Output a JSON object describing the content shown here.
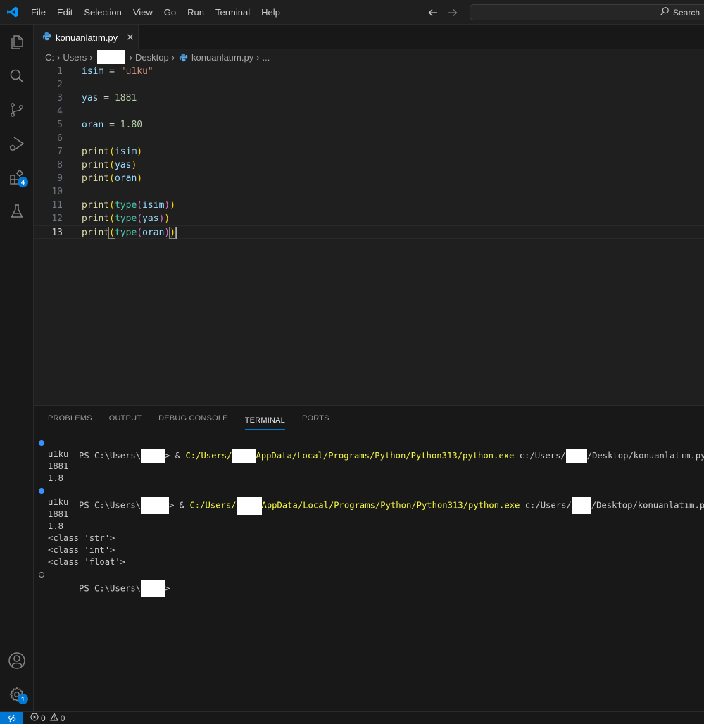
{
  "menu": [
    "File",
    "Edit",
    "Selection",
    "View",
    "Go",
    "Run",
    "Terminal",
    "Help"
  ],
  "search": {
    "label": "Search"
  },
  "activity": {
    "extensions_badge": "4",
    "settings_badge": "1"
  },
  "tab": {
    "label": "konuanlatım.py",
    "close": "×"
  },
  "breadcrumb": {
    "drive": "C:",
    "users": "Users",
    "desktop": "Desktop",
    "file": "konuanlatım.py",
    "more": "..."
  },
  "editor": {
    "line_numbers": [
      "1",
      "2",
      "3",
      "4",
      "5",
      "6",
      "7",
      "8",
      "9",
      "10",
      "11",
      "12",
      "13"
    ],
    "current_line": 13,
    "code": {
      "l1_var": "isim",
      "l1_op": " = ",
      "l1_val": "\"u1ku\"",
      "l3_var": "yas",
      "l3_op": " = ",
      "l3_val": "1881",
      "l5_var": "oran",
      "l5_op": " = ",
      "l5_val": "1.80",
      "print": "print",
      "type": "type",
      "isim": "isim",
      "yas": "yas",
      "oran": "oran",
      "lp": "(",
      "rp": ")"
    }
  },
  "panel": {
    "tabs": [
      "PROBLEMS",
      "OUTPUT",
      "DEBUG CONSOLE",
      "TERMINAL",
      "PORTS"
    ],
    "active_tab": "TERMINAL"
  },
  "terminal": {
    "ps_prefix": "PS C:\\Users\\",
    "amp": " & ",
    "py_prefix": "C:/Users/",
    "py_suffix": "AppData/Local/Programs/Python/Python313/python.exe",
    "arg_prefix": " c:/Users/",
    "arg_suffix": "/Desktop/konuanlatım.py",
    "run1_output": [
      "u1ku",
      "1881",
      "1.8"
    ],
    "run2_output": [
      "u1ku",
      "1881",
      "1.8",
      "<class 'str'>",
      "<class 'int'>",
      "<class 'float'>"
    ],
    "prompt_end": ">"
  },
  "status": {
    "errors": "0",
    "warnings": "0"
  }
}
